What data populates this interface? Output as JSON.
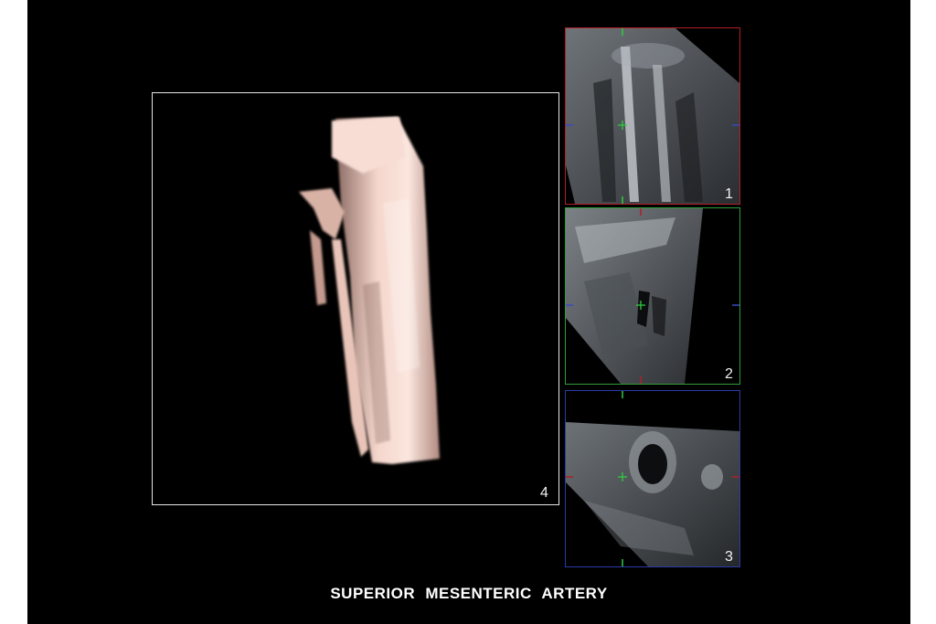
{
  "caption": "SUPERIOR MESENTERIC ARTERY",
  "views": {
    "render": {
      "number": "4",
      "frame_color": "#e6e6e6",
      "volume_color": "#f2cfc4"
    },
    "slice1": {
      "number": "1",
      "frame_color": "#b01f24",
      "crosshair_color": "#2ecc40"
    },
    "slice2": {
      "number": "2",
      "frame_color": "#2f9e3a",
      "crosshair_color": "#2ecc40"
    },
    "slice3": {
      "number": "3",
      "frame_color": "#2b3aa8",
      "crosshair_color": "#2ecc40"
    }
  },
  "icons": {
    "crosshair": "crosshair-icon"
  }
}
